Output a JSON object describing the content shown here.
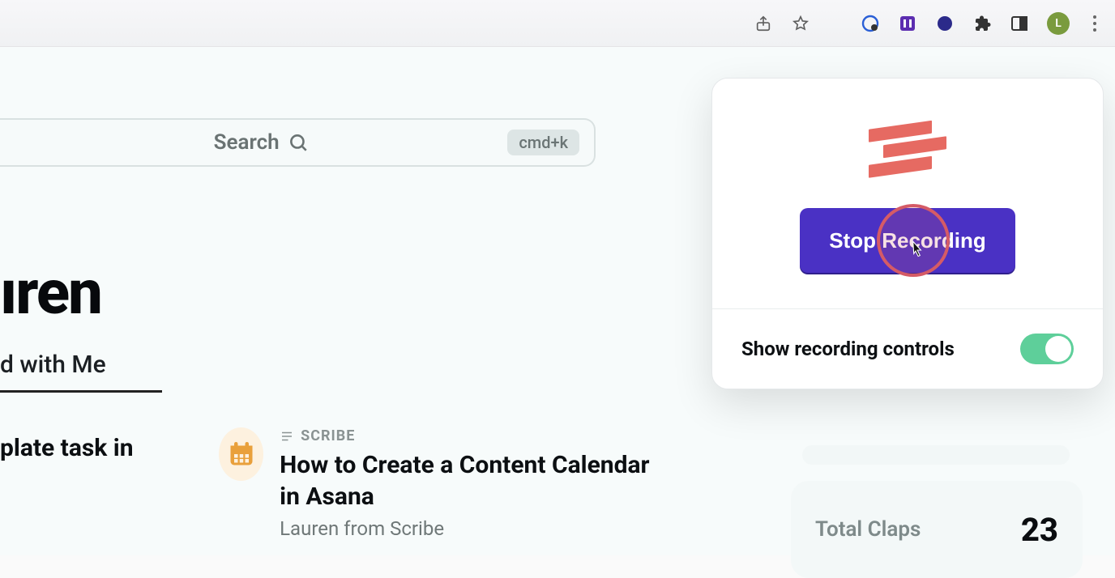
{
  "chrome": {
    "avatar_initial": "L"
  },
  "search": {
    "placeholder": "Search",
    "shortcut": "cmd+k"
  },
  "heading": "ıren",
  "tab": {
    "label": "d with Me"
  },
  "cards": [
    {
      "type_label": "",
      "title_fragment": "plate task in",
      "author": ""
    },
    {
      "type_label": "SCRIBE",
      "title": "How to Create a Content Calendar in Asana",
      "author": "Lauren from Scribe"
    }
  ],
  "stats": {
    "claps_label": "Total Claps",
    "claps_value": "23"
  },
  "extension": {
    "stop_label": "Stop Recording",
    "controls_label": "Show recording controls",
    "controls_on": true
  }
}
